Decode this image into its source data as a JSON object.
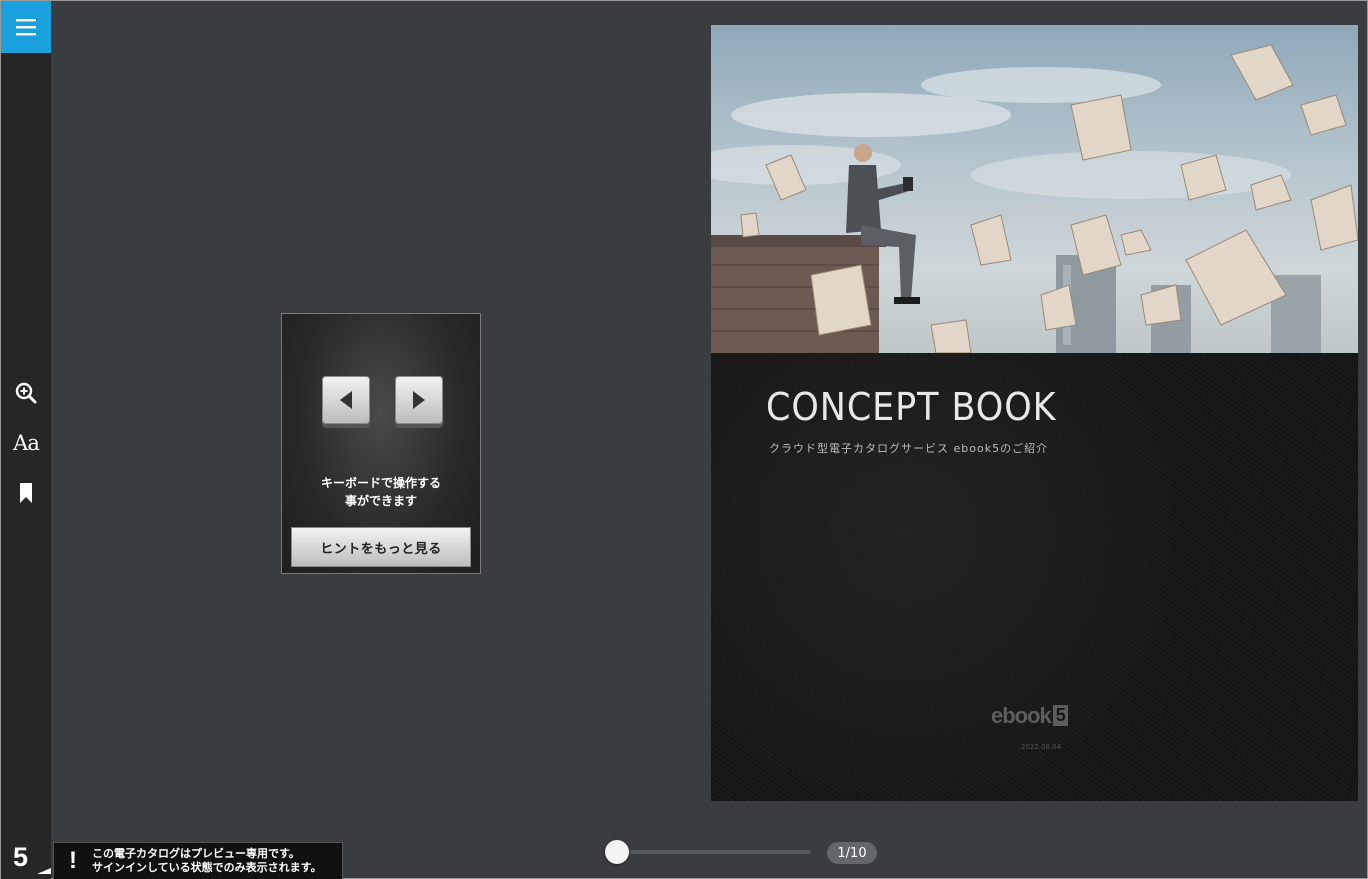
{
  "sidebar": {
    "menu_icon": "hamburger-menu-icon",
    "menu_color": "#1aa0dc",
    "tools": [
      {
        "name": "zoom-in-icon"
      },
      {
        "name": "font-size-icon",
        "label": "Aa"
      },
      {
        "name": "bookmark-icon"
      }
    ],
    "logo_text": "5"
  },
  "preview_notice": {
    "mark": "!",
    "line1": "この電子カタログはプレビュー専用です。",
    "line2": "サインインしている状態でのみ表示されます。"
  },
  "hint": {
    "text_line1": "キーボードで操作する",
    "text_line2": "事ができます",
    "button_label": "ヒントをもっと見る"
  },
  "book_page": {
    "title": "CONCEPT BOOK",
    "subtitle": "クラウド型電子カタログサービス ebook5のご紹介",
    "logo_text": "ebook",
    "logo_num": "5",
    "date": "2022.08.04"
  },
  "navigation": {
    "current_page": 1,
    "total_pages": 10,
    "counter_text": "1/10",
    "progress": 0.0
  }
}
